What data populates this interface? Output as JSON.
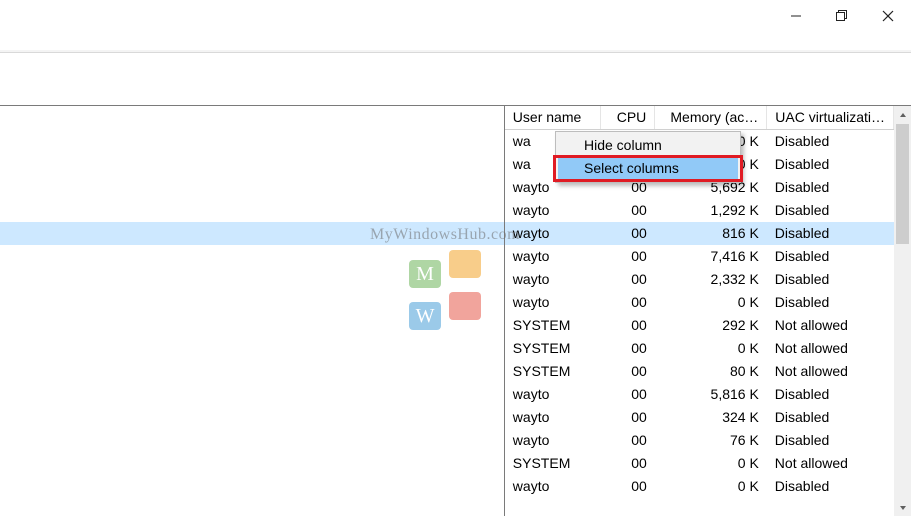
{
  "window": {
    "minimize_title": "Minimize",
    "maximize_title": "Restore",
    "close_title": "Close"
  },
  "watermark": {
    "text": "MyWindowsHub.com",
    "tiles": [
      "M",
      "",
      "W",
      ""
    ]
  },
  "context_menu": {
    "items": [
      {
        "id": "hide-column",
        "label": "Hide column",
        "hover": false
      },
      {
        "id": "select-columns",
        "label": "Select columns",
        "hover": true
      }
    ]
  },
  "columns": [
    {
      "id": "user",
      "label": "User name",
      "align": "left"
    },
    {
      "id": "cpu",
      "label": "CPU",
      "align": "right"
    },
    {
      "id": "mem",
      "label": "Memory (ac…",
      "align": "right"
    },
    {
      "id": "uac",
      "label": "UAC virtualizati…",
      "align": "left"
    }
  ],
  "selected_row_index": 4,
  "rows": [
    {
      "user": "wa",
      "cpu": "",
      "mem": "0 K",
      "uac": "Disabled"
    },
    {
      "user": "wa",
      "cpu": "",
      "mem": "0 K",
      "uac": "Disabled"
    },
    {
      "user": "wayto",
      "cpu": "00",
      "mem": "5,692 K",
      "uac": "Disabled"
    },
    {
      "user": "wayto",
      "cpu": "00",
      "mem": "1,292 K",
      "uac": "Disabled"
    },
    {
      "user": "wayto",
      "cpu": "00",
      "mem": "816 K",
      "uac": "Disabled"
    },
    {
      "user": "wayto",
      "cpu": "00",
      "mem": "7,416 K",
      "uac": "Disabled"
    },
    {
      "user": "wayto",
      "cpu": "00",
      "mem": "2,332 K",
      "uac": "Disabled"
    },
    {
      "user": "wayto",
      "cpu": "00",
      "mem": "0 K",
      "uac": "Disabled"
    },
    {
      "user": "SYSTEM",
      "cpu": "00",
      "mem": "292 K",
      "uac": "Not allowed"
    },
    {
      "user": "SYSTEM",
      "cpu": "00",
      "mem": "0 K",
      "uac": "Not allowed"
    },
    {
      "user": "SYSTEM",
      "cpu": "00",
      "mem": "80 K",
      "uac": "Not allowed"
    },
    {
      "user": "wayto",
      "cpu": "00",
      "mem": "5,816 K",
      "uac": "Disabled"
    },
    {
      "user": "wayto",
      "cpu": "00",
      "mem": "324 K",
      "uac": "Disabled"
    },
    {
      "user": "wayto",
      "cpu": "00",
      "mem": "76 K",
      "uac": "Disabled"
    },
    {
      "user": "SYSTEM",
      "cpu": "00",
      "mem": "0 K",
      "uac": "Not allowed"
    },
    {
      "user": "wayto",
      "cpu": "00",
      "mem": "0 K",
      "uac": "Disabled"
    }
  ]
}
